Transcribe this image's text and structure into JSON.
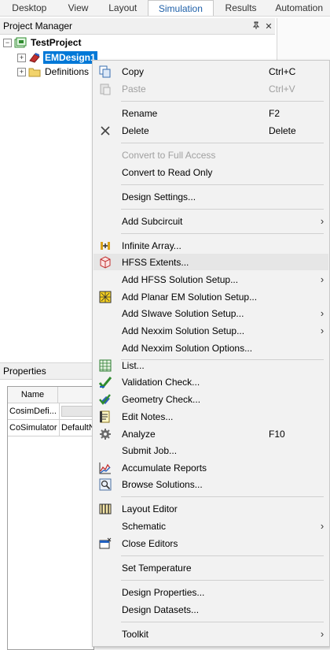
{
  "ribbon": {
    "tabs": [
      {
        "label": "Desktop"
      },
      {
        "label": "View"
      },
      {
        "label": "Layout"
      },
      {
        "label": "Simulation"
      },
      {
        "label": "Results"
      },
      {
        "label": "Automation"
      }
    ],
    "active_tab": "Simulation"
  },
  "project_manager": {
    "title": "Project Manager",
    "pin_glyph": "📌",
    "close_glyph": "✕",
    "tree": {
      "root": "TestProject",
      "design": "EMDesign1",
      "definitions": "Definitions",
      "expander_collapsed": "+",
      "expander_expanded": "−"
    }
  },
  "properties": {
    "title": "Properties",
    "column_name": "Name",
    "rows": [
      {
        "name": "CosimDefi...",
        "value": ""
      },
      {
        "name": "CoSimulator",
        "value": "DefaultN"
      }
    ]
  },
  "context_menu": {
    "copy": {
      "label": "Copy",
      "shortcut": "Ctrl+C",
      "icon": "copy-icon"
    },
    "paste": {
      "label": "Paste",
      "shortcut": "Ctrl+V",
      "icon": "paste-icon"
    },
    "rename": {
      "label": "Rename",
      "shortcut": "F2"
    },
    "delete": {
      "label": "Delete",
      "shortcut": "Delete",
      "icon": "x-icon"
    },
    "convert_full": {
      "label": "Convert to Full Access"
    },
    "convert_readonly": {
      "label": "Convert to Read Only"
    },
    "design_settings": {
      "label": "Design Settings..."
    },
    "add_subcircuit": {
      "label": "Add Subcircuit"
    },
    "infinite_array": {
      "label": "Infinite Array...",
      "icon": "infinite-array-icon"
    },
    "hfss_extents": {
      "label": "HFSS Extents...",
      "icon": "hfss-extents-icon"
    },
    "add_hfss_setup": {
      "label": "Add HFSS Solution Setup..."
    },
    "add_planar_em": {
      "label": "Add Planar EM Solution Setup...",
      "icon": "planar-em-icon"
    },
    "add_siwave": {
      "label": "Add SIwave Solution Setup..."
    },
    "add_nexxim_setup": {
      "label": "Add Nexxim Solution Setup..."
    },
    "add_nexxim_options": {
      "label": "Add Nexxim Solution Options..."
    },
    "list": {
      "label": "List...",
      "icon": "list-icon"
    },
    "validation_check": {
      "label": "Validation Check...",
      "icon": "check-icon"
    },
    "geometry_check": {
      "label": "Geometry Check...",
      "icon": "geometry-check-icon"
    },
    "edit_notes": {
      "label": "Edit Notes...",
      "icon": "notes-icon"
    },
    "analyze": {
      "label": "Analyze",
      "shortcut": "F10",
      "icon": "gear-icon"
    },
    "submit_job": {
      "label": "Submit Job..."
    },
    "accumulate_reports": {
      "label": "Accumulate Reports",
      "icon": "chart-icon"
    },
    "browse_solutions": {
      "label": "Browse Solutions...",
      "icon": "browse-icon"
    },
    "layout_editor": {
      "label": "Layout Editor",
      "icon": "layout-editor-icon"
    },
    "schematic": {
      "label": "Schematic"
    },
    "close_editors": {
      "label": "Close Editors",
      "icon": "close-editors-icon"
    },
    "set_temperature": {
      "label": "Set Temperature"
    },
    "design_properties": {
      "label": "Design Properties..."
    },
    "design_datasets": {
      "label": "Design Datasets..."
    },
    "toolkit": {
      "label": "Toolkit"
    },
    "submenu_arrow": "›"
  }
}
